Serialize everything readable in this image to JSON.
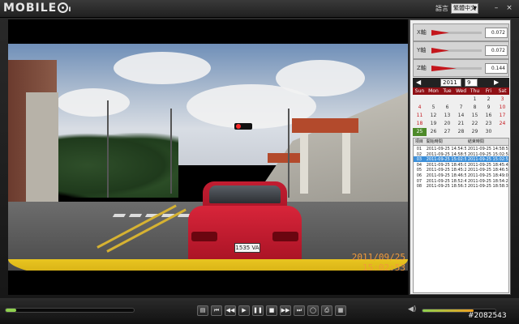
{
  "header": {
    "logo_text": "MOBILE",
    "language_label": "語言",
    "language_value": "繁體中文",
    "minimize": "–",
    "close": "×"
  },
  "video": {
    "overlay_date": "2011/09/25",
    "overlay_time": "15:02:53",
    "plate": "1535 VA"
  },
  "gsensor": [
    {
      "axis": "X軸",
      "value": "0.072",
      "level": 0.35
    },
    {
      "axis": "Y軸",
      "value": "0.072",
      "level": 0.35
    },
    {
      "axis": "Z軸",
      "value": "0.144",
      "level": 0.5
    }
  ],
  "calendar": {
    "year": "2011",
    "month": "9",
    "prev": "◀",
    "next": "▶",
    "weekdays": [
      "Sun",
      "Mon",
      "Tue",
      "Wed",
      "Thu",
      "Fri",
      "Sat"
    ],
    "rows": [
      [
        "",
        "",
        "",
        "",
        "1",
        "2",
        "3"
      ],
      [
        "4",
        "5",
        "6",
        "7",
        "8",
        "9",
        "10"
      ],
      [
        "11",
        "12",
        "13",
        "14",
        "15",
        "16",
        "17"
      ],
      [
        "18",
        "19",
        "20",
        "21",
        "22",
        "23",
        "24"
      ],
      [
        "25",
        "26",
        "27",
        "28",
        "29",
        "30",
        ""
      ]
    ],
    "today": "25"
  },
  "filelist": {
    "headers": [
      "項目",
      "開始時間",
      "結束時間"
    ],
    "rows": [
      [
        "01",
        "2011-09-25 14:54:57",
        "2011-09-25 14:58:53"
      ],
      [
        "02",
        "2011-09-25 14:58:54",
        "2011-09-25 15:02:50"
      ],
      [
        "03",
        "2011-09-25 15:02:50",
        "2011-09-25 15:02:51"
      ],
      [
        "04",
        "2011-09-25 18:45:08",
        "2011-09-25 18:45:47"
      ],
      [
        "05",
        "2011-09-25 18:45:23",
        "2011-09-25 18:46:55"
      ],
      [
        "06",
        "2011-09-25 18:46:56",
        "2011-09-25 18:49:05"
      ],
      [
        "07",
        "2011-09-25 18:52:43",
        "2011-09-25 18:54:20"
      ],
      [
        "08",
        "2011-09-25 18:56:37",
        "2011-09-25 18:58:37"
      ]
    ],
    "selected_index": 2
  },
  "playback": {
    "progress": 0.08,
    "volume": 0.7,
    "buttons": [
      {
        "name": "open-folder-button",
        "glyph": "▤"
      },
      {
        "name": "skip-start-button",
        "glyph": "⏮"
      },
      {
        "name": "rewind-button",
        "glyph": "◀◀"
      },
      {
        "name": "play-button",
        "glyph": "▶"
      },
      {
        "name": "pause-button",
        "glyph": "❚❚"
      },
      {
        "name": "stop-button",
        "glyph": "■"
      },
      {
        "name": "fast-forward-button",
        "glyph": "▶▶"
      },
      {
        "name": "skip-end-button",
        "glyph": "⏭"
      },
      {
        "name": "repeat-button",
        "glyph": "◯"
      },
      {
        "name": "print-button",
        "glyph": "⎙"
      },
      {
        "name": "settings-button",
        "glyph": "▦"
      }
    ]
  },
  "watermark": "#2082543"
}
